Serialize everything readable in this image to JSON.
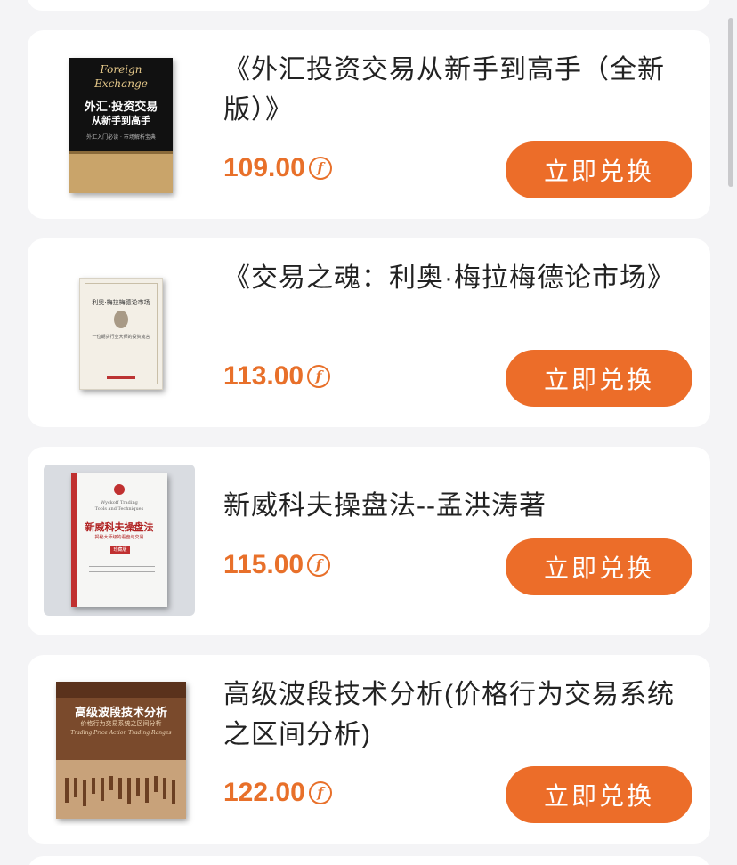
{
  "products": [
    {
      "title": "《外汇投资交易从新手到高手（全新版）》",
      "price": "109.00",
      "cover": {
        "en_line1": "Foreign",
        "en_line2": "Exchange",
        "cn_title": "外汇·投资交易",
        "cn_sub": "从新手到高手",
        "slogan": "外汇入门必读 · 市场解析宝典"
      }
    },
    {
      "title": "《交易之魂：利奥·梅拉梅德论市场》",
      "price": "113.00",
      "cover": {
        "cn_title": "利奥·梅拉梅德论市场",
        "cn_sub": "一位期货行业大师的投资箴言"
      }
    },
    {
      "title": "新威科夫操盘法--孟洪涛著",
      "price": "115.00",
      "cover": {
        "en_line1": "Wyckoff Trading",
        "en_line2": "Tools and Techniques",
        "cn_title": "新威科夫操盘法",
        "cn_sub": "揭秘大师级的看盘与交易",
        "badge": "珍藏版"
      }
    },
    {
      "title": "高级波段技术分析(价格行为交易系统之区间分析)",
      "price": "122.00",
      "cover": {
        "cn_title": "高级波段技术分析",
        "cn_sub": "价格行为交易系统之区间分析",
        "en_line1": "Trading Price Action Trading Ranges"
      }
    }
  ],
  "labels": {
    "redeem": "立即兑换",
    "coin_symbol": "f"
  },
  "colors": {
    "accent": "#ec6d29",
    "price": "#e8702a",
    "background": "#f4f4f6",
    "card": "#ffffff"
  },
  "icons": {
    "coin": "coin-currency-icon"
  }
}
